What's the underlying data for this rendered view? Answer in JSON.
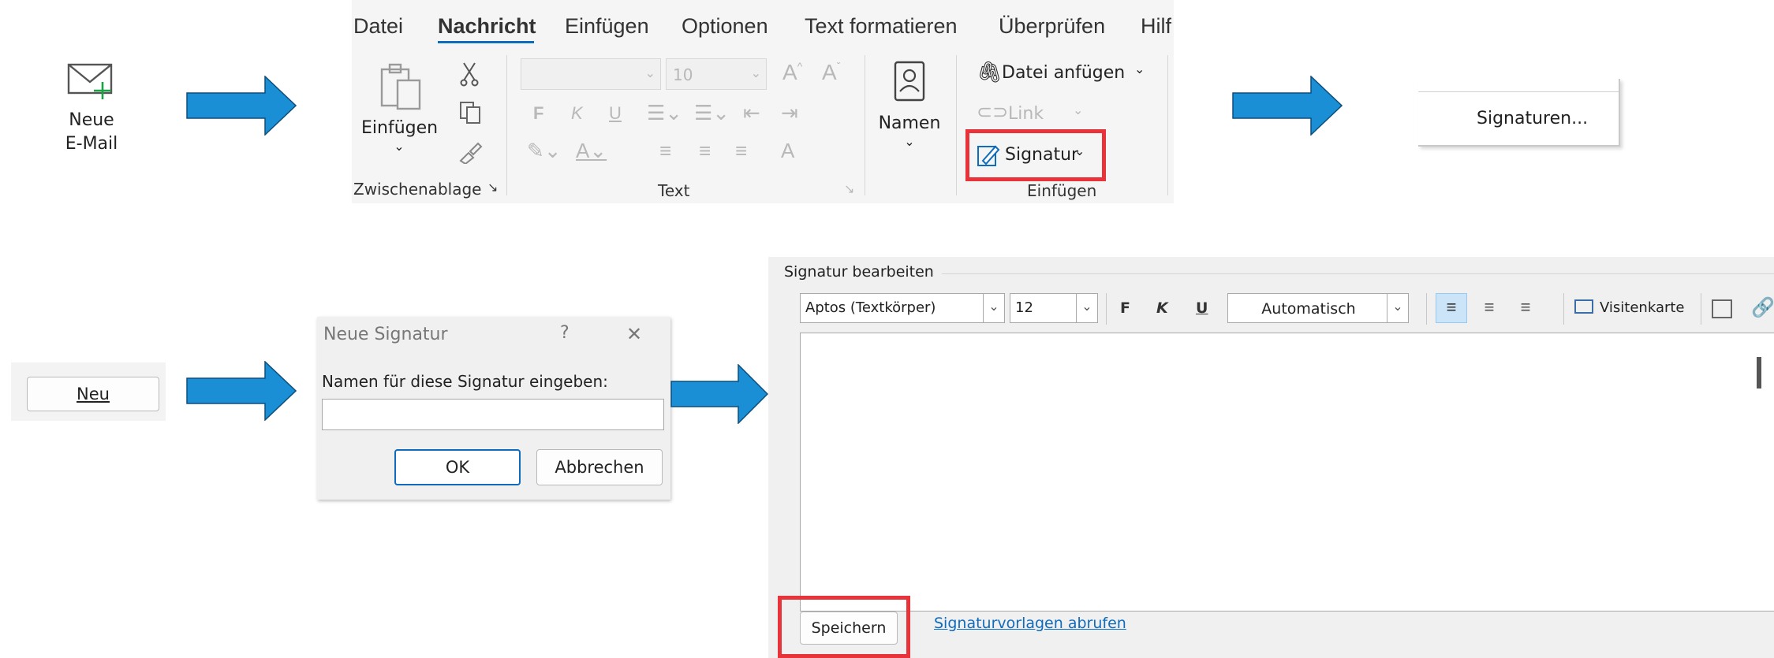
{
  "step1": {
    "label_line1": "Neue",
    "label_line2": "E-Mail"
  },
  "ribbon": {
    "tabs": [
      "Datei",
      "Nachricht",
      "Einfügen",
      "Optionen",
      "Text formatieren",
      "Überprüfen",
      "Hilf"
    ],
    "paste_label": "Einfügen",
    "clipboard_group": "Zwischenablage",
    "font_size_value": "10",
    "bold": "F",
    "italic": "K",
    "underline": "U",
    "text_group": "Text",
    "names_label": "Namen",
    "attach_label": "Datei anfügen",
    "link_label": "Link",
    "signature_label": "Signatur",
    "insert_group": "Einfügen",
    "highlight_color": "#e8333a"
  },
  "step3": {
    "menu_item": "Signaturen..."
  },
  "step4": {
    "new_button": "Neu"
  },
  "dialog": {
    "title": "Neue Signatur",
    "help": "?",
    "close": "✕",
    "prompt": "Namen für diese Signatur eingeben:",
    "ok": "OK",
    "cancel": "Abbrechen"
  },
  "editor": {
    "group_label": "Signatur bearbeiten",
    "font_name": "Aptos (Textkörper)",
    "font_size": "12",
    "bold": "F",
    "italic": "K",
    "underline": "U",
    "color": "Automatisch",
    "business_card": "Visitenkarte",
    "save": "Speichern",
    "templates_link": "Signaturvorlagen abrufen"
  },
  "colors": {
    "arrow": "#1a8fd6",
    "accent": "#0f6cbd",
    "highlight": "#e8333a"
  }
}
